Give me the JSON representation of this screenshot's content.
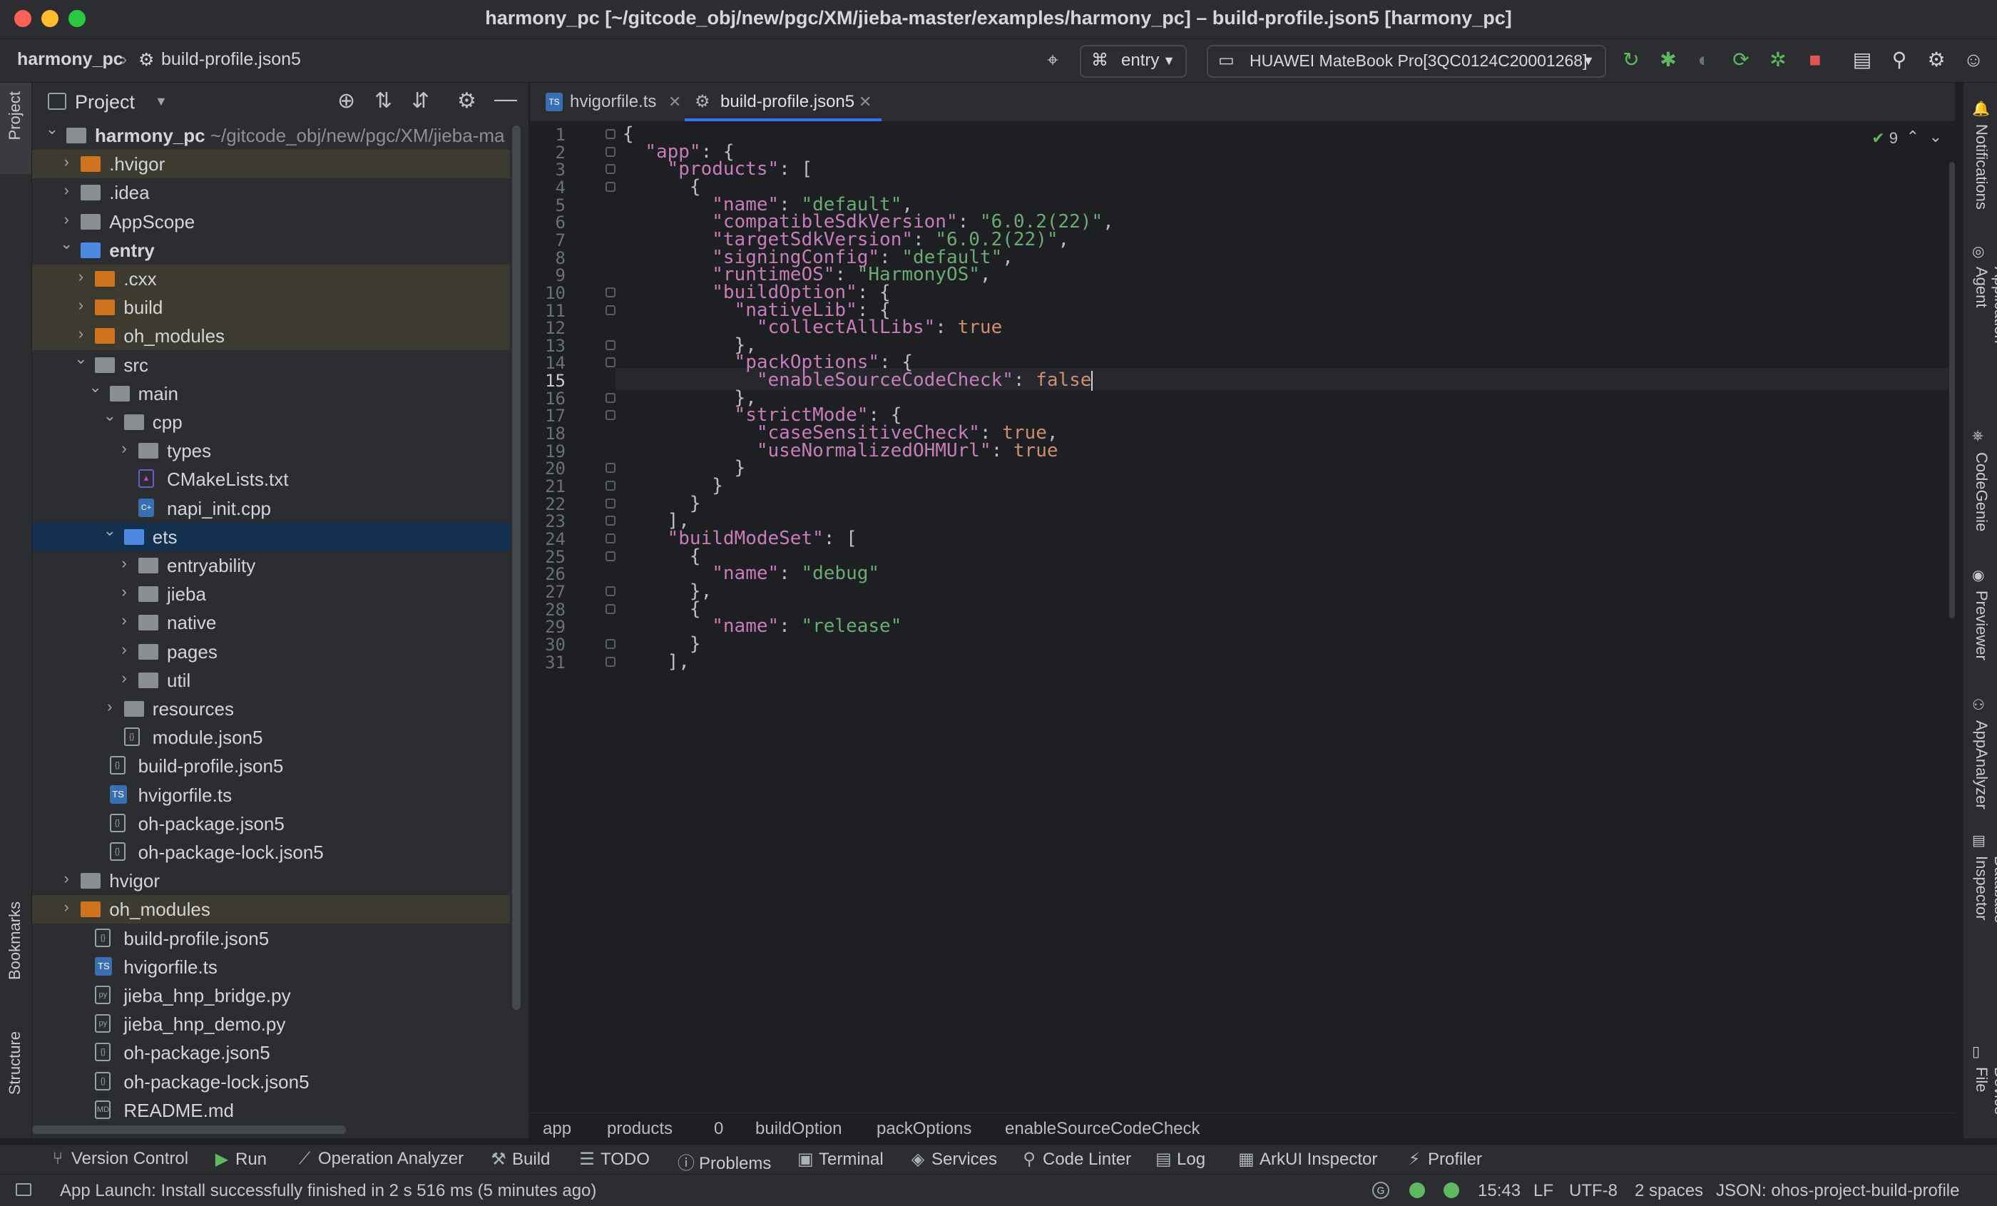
{
  "window": {
    "title": "harmony_pc [~/gitcode_obj/new/pgc/XM/jieba-master/examples/harmony_pc] – build-profile.json5 [harmony_pc]"
  },
  "navbar": {
    "breadcrumb": [
      "harmony_pc",
      "build-profile.json5"
    ],
    "run_config": "entry",
    "device": "HUAWEI MateBook Pro[3QC0124C20001268]"
  },
  "left_stripe": {
    "top_label": "Project",
    "bookmarks_label": "Bookmarks",
    "structure_label": "Structure"
  },
  "project_panel": {
    "title": "Project",
    "tree": [
      {
        "label": "harmony_pc",
        "path": "~/gitcode_obj/new/pgc/XM/jieba-ma",
        "depth": 0,
        "expanded": true,
        "icon": "folder-gray",
        "bold": true
      },
      {
        "label": ".hvigor",
        "depth": 1,
        "expanded": false,
        "icon": "folder-orange",
        "hl": "excl"
      },
      {
        "label": ".idea",
        "depth": 1,
        "expanded": false,
        "icon": "folder-gray"
      },
      {
        "label": "AppScope",
        "depth": 1,
        "expanded": false,
        "icon": "folder-gray"
      },
      {
        "label": "entry",
        "depth": 1,
        "expanded": true,
        "icon": "folder-blue",
        "bold": true
      },
      {
        "label": ".cxx",
        "depth": 2,
        "expanded": false,
        "icon": "folder-orange",
        "hl": "excl"
      },
      {
        "label": "build",
        "depth": 2,
        "expanded": false,
        "icon": "folder-orange",
        "hl": "excl"
      },
      {
        "label": "oh_modules",
        "depth": 2,
        "expanded": false,
        "icon": "folder-orange",
        "hl": "excl"
      },
      {
        "label": "src",
        "depth": 2,
        "expanded": true,
        "icon": "folder-gray"
      },
      {
        "label": "main",
        "depth": 3,
        "expanded": true,
        "icon": "folder-gray"
      },
      {
        "label": "cpp",
        "depth": 4,
        "expanded": true,
        "icon": "folder-gray"
      },
      {
        "label": "types",
        "depth": 5,
        "expanded": false,
        "icon": "folder-gray"
      },
      {
        "label": "CMakeLists.txt",
        "depth": 5,
        "icon": "cmake"
      },
      {
        "label": "napi_init.cpp",
        "depth": 5,
        "icon": "cpp"
      },
      {
        "label": "ets",
        "depth": 4,
        "expanded": true,
        "icon": "folder-blue",
        "hl": "sel"
      },
      {
        "label": "entryability",
        "depth": 5,
        "expanded": false,
        "icon": "folder-gray"
      },
      {
        "label": "jieba",
        "depth": 5,
        "expanded": false,
        "icon": "folder-gray"
      },
      {
        "label": "native",
        "depth": 5,
        "expanded": false,
        "icon": "folder-gray"
      },
      {
        "label": "pages",
        "depth": 5,
        "expanded": false,
        "icon": "folder-gray"
      },
      {
        "label": "util",
        "depth": 5,
        "expanded": false,
        "icon": "folder-gray"
      },
      {
        "label": "resources",
        "depth": 4,
        "expanded": false,
        "icon": "folder-gray"
      },
      {
        "label": "module.json5",
        "depth": 4,
        "icon": "json"
      },
      {
        "label": "build-profile.json5",
        "depth": 3,
        "icon": "json"
      },
      {
        "label": "hvigorfile.ts",
        "depth": 3,
        "icon": "ts"
      },
      {
        "label": "oh-package.json5",
        "depth": 3,
        "icon": "json"
      },
      {
        "label": "oh-package-lock.json5",
        "depth": 3,
        "icon": "json"
      },
      {
        "label": "hvigor",
        "depth": 1,
        "expanded": false,
        "icon": "folder-gray"
      },
      {
        "label": "oh_modules",
        "depth": 1,
        "expanded": false,
        "icon": "folder-orange",
        "hl": "excl"
      },
      {
        "label": "build-profile.json5",
        "depth": 2,
        "icon": "json"
      },
      {
        "label": "hvigorfile.ts",
        "depth": 2,
        "icon": "ts"
      },
      {
        "label": "jieba_hnp_bridge.py",
        "depth": 2,
        "icon": "py"
      },
      {
        "label": "jieba_hnp_demo.py",
        "depth": 2,
        "icon": "py"
      },
      {
        "label": "oh-package.json5",
        "depth": 2,
        "icon": "json"
      },
      {
        "label": "oh-package-lock.json5",
        "depth": 2,
        "icon": "json"
      },
      {
        "label": "README.md",
        "depth": 2,
        "icon": "md"
      }
    ]
  },
  "editor_tabs": [
    {
      "label": "hvigorfile.ts",
      "icon": "ts",
      "active": false
    },
    {
      "label": "build-profile.json5",
      "icon": "json",
      "active": true
    }
  ],
  "editor": {
    "inspection_count": "9",
    "current_line": 15,
    "lines": [
      [
        [
          "p",
          "{"
        ]
      ],
      [
        [
          "p",
          "  "
        ],
        [
          "k",
          "\"app\""
        ],
        [
          "p",
          ": {"
        ]
      ],
      [
        [
          "p",
          "    "
        ],
        [
          "k",
          "\"products\""
        ],
        [
          "p",
          ": ["
        ]
      ],
      [
        [
          "p",
          "      {"
        ]
      ],
      [
        [
          "p",
          "        "
        ],
        [
          "k",
          "\"name\""
        ],
        [
          "p",
          ": "
        ],
        [
          "s",
          "\"default\""
        ],
        [
          "p",
          ","
        ]
      ],
      [
        [
          "p",
          "        "
        ],
        [
          "k",
          "\"compatibleSdkVersion\""
        ],
        [
          "p",
          ": "
        ],
        [
          "s",
          "\"6.0.2(22)\""
        ],
        [
          "p",
          ","
        ]
      ],
      [
        [
          "p",
          "        "
        ],
        [
          "k",
          "\"targetSdkVersion\""
        ],
        [
          "p",
          ": "
        ],
        [
          "s",
          "\"6.0.2(22)\""
        ],
        [
          "p",
          ","
        ]
      ],
      [
        [
          "p",
          "        "
        ],
        [
          "k",
          "\"signingConfig\""
        ],
        [
          "p",
          ": "
        ],
        [
          "s",
          "\"default\""
        ],
        [
          "p",
          ","
        ]
      ],
      [
        [
          "p",
          "        "
        ],
        [
          "k",
          "\"runtimeOS\""
        ],
        [
          "p",
          ": "
        ],
        [
          "s",
          "\"HarmonyOS\""
        ],
        [
          "p",
          ","
        ]
      ],
      [
        [
          "p",
          "        "
        ],
        [
          "k",
          "\"buildOption\""
        ],
        [
          "p",
          ": {"
        ]
      ],
      [
        [
          "p",
          "          "
        ],
        [
          "k",
          "\"nativeLib\""
        ],
        [
          "p",
          ": {"
        ]
      ],
      [
        [
          "p",
          "            "
        ],
        [
          "k",
          "\"collectAllLibs\""
        ],
        [
          "p",
          ": "
        ],
        [
          "b",
          "true"
        ]
      ],
      [
        [
          "p",
          "          },"
        ]
      ],
      [
        [
          "p",
          "          "
        ],
        [
          "k",
          "\"packOptions\""
        ],
        [
          "p",
          ": {"
        ]
      ],
      [
        [
          "p",
          "            "
        ],
        [
          "k",
          "\"enableSourceCodeCheck\""
        ],
        [
          "p",
          ": "
        ],
        [
          "b",
          "false"
        ]
      ],
      [
        [
          "p",
          "          },"
        ]
      ],
      [
        [
          "p",
          "          "
        ],
        [
          "k",
          "\"strictMode\""
        ],
        [
          "p",
          ": {"
        ]
      ],
      [
        [
          "p",
          "            "
        ],
        [
          "k",
          "\"caseSensitiveCheck\""
        ],
        [
          "p",
          ": "
        ],
        [
          "b",
          "true"
        ],
        [
          "p",
          ","
        ]
      ],
      [
        [
          "p",
          "            "
        ],
        [
          "k",
          "\"useNormalizedOHMUrl\""
        ],
        [
          "p",
          ": "
        ],
        [
          "b",
          "true"
        ]
      ],
      [
        [
          "p",
          "          }"
        ]
      ],
      [
        [
          "p",
          "        }"
        ]
      ],
      [
        [
          "p",
          "      }"
        ]
      ],
      [
        [
          "p",
          "    ],"
        ]
      ],
      [
        [
          "p",
          "    "
        ],
        [
          "k",
          "\"buildModeSet\""
        ],
        [
          "p",
          ": ["
        ]
      ],
      [
        [
          "p",
          "      {"
        ]
      ],
      [
        [
          "p",
          "        "
        ],
        [
          "k",
          "\"name\""
        ],
        [
          "p",
          ": "
        ],
        [
          "s",
          "\"debug\""
        ]
      ],
      [
        [
          "p",
          "      },"
        ]
      ],
      [
        [
          "p",
          "      {"
        ]
      ],
      [
        [
          "p",
          "        "
        ],
        [
          "k",
          "\"name\""
        ],
        [
          "p",
          ": "
        ],
        [
          "s",
          "\"release\""
        ]
      ],
      [
        [
          "p",
          "      }"
        ]
      ],
      [
        [
          "p",
          "    ],"
        ]
      ]
    ],
    "fold_lines": [
      1,
      2,
      3,
      4,
      10,
      11,
      13,
      14,
      16,
      17,
      20,
      21,
      22,
      23,
      24,
      25,
      27,
      28,
      30,
      31
    ]
  },
  "editor_breadcrumbs": [
    "app",
    "products",
    "0",
    "buildOption",
    "packOptions",
    "enableSourceCodeCheck"
  ],
  "right_stripe": [
    "Notifications",
    "Application Agent",
    "CodeGenie",
    "Previewer",
    "AppAnalyzer",
    "Database Inspector",
    "Device File"
  ],
  "bottom_tools": [
    {
      "label": "Version Control",
      "icon": "⑂"
    },
    {
      "label": "Run",
      "icon": "▶"
    },
    {
      "label": "Operation Analyzer",
      "icon": "⟋"
    },
    {
      "label": "Build",
      "icon": "⚒"
    },
    {
      "label": "TODO",
      "icon": "☰"
    },
    {
      "label": "Problems",
      "icon": "ⓘ"
    },
    {
      "label": "Terminal",
      "icon": "▣"
    },
    {
      "label": "Services",
      "icon": "◈"
    },
    {
      "label": "Code Linter",
      "icon": "⚲"
    },
    {
      "label": "Log",
      "icon": "▤"
    },
    {
      "label": "ArkUI Inspector",
      "icon": "▦"
    },
    {
      "label": "Profiler",
      "icon": "⚡"
    }
  ],
  "status_bar": {
    "message": "App Launch: Install successfully finished in 2 s 516 ms (5 minutes ago)",
    "time": "15:43",
    "line_sep": "LF",
    "encoding": "UTF-8",
    "indent": "2 spaces",
    "schema": "JSON: ohos-project-build-profile"
  },
  "colors": {
    "accent": "#3574f0",
    "keyword": "#c77dbb",
    "string": "#6aab73",
    "boolean": "#cf8e6d",
    "run_green": "#5fb85f",
    "stop_red": "#e05555"
  }
}
